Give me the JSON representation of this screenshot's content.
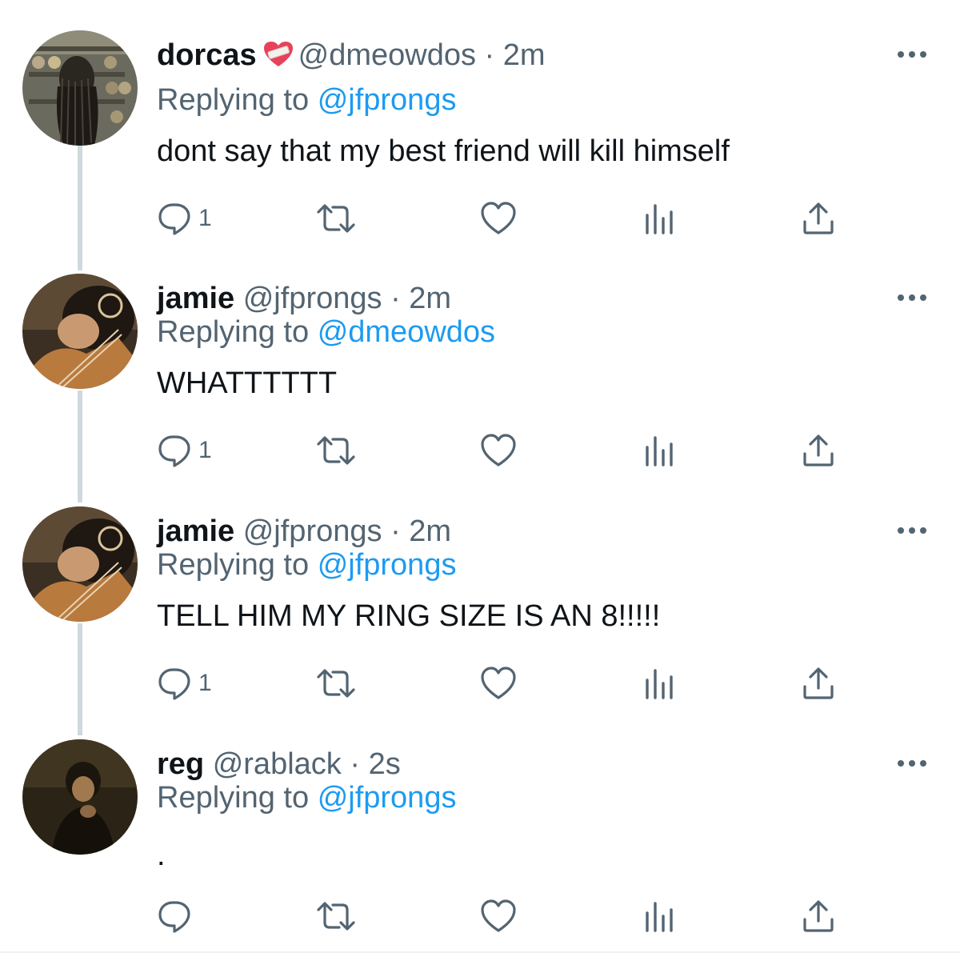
{
  "colors": {
    "accent": "#1d9bf0",
    "text": "#0f1419",
    "muted": "#536471",
    "thread_line": "#cfd9de"
  },
  "tweets": [
    {
      "name": "dorcas",
      "badge_icon": "mending-heart-emoji",
      "handle": "@dmeowdos",
      "separator": "·",
      "time": "2m",
      "replying_label": "Replying to",
      "replying_to": "@jfprongs",
      "text": "dont say that my best friend will kill himself",
      "reply_count": "1"
    },
    {
      "name": "jamie",
      "handle": "@jfprongs",
      "separator": "·",
      "time": "2m",
      "replying_label": "Replying to",
      "replying_to": "@dmeowdos",
      "text": "WHATTTTTT",
      "reply_count": "1"
    },
    {
      "name": "jamie",
      "handle": "@jfprongs",
      "separator": "·",
      "time": "2m",
      "replying_label": "Replying to",
      "replying_to": "@jfprongs",
      "text": "TELL HIM MY RING SIZE IS AN 8!!!!!",
      "reply_count": "1"
    },
    {
      "name": "reg",
      "handle": "@rablack",
      "separator": "·",
      "time": "2s",
      "replying_label": "Replying to",
      "replying_to": "@jfprongs",
      "text": ".",
      "reply_count": ""
    }
  ],
  "icons": [
    "more-icon",
    "reply-icon",
    "retweet-icon",
    "like-icon",
    "views-icon",
    "share-icon"
  ]
}
